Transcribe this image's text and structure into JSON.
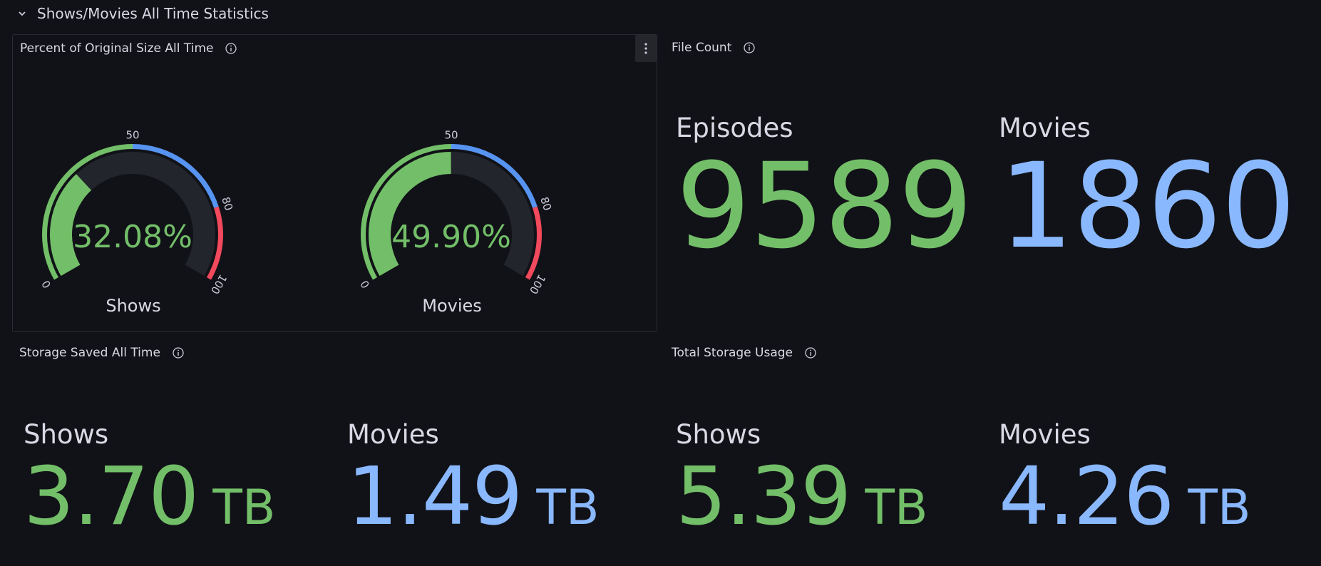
{
  "row": {
    "title": "Shows/Movies All Time Statistics"
  },
  "percent_panel": {
    "title": "Percent of Original Size All Time",
    "gauges": [
      {
        "label": "Shows",
        "value": 32.08,
        "display": "32.08%"
      },
      {
        "label": "Movies",
        "value": 49.9,
        "display": "49.90%"
      }
    ],
    "ticks": [
      "0",
      "50",
      "80",
      "100"
    ],
    "thresholds": {
      "green": "#73bf69",
      "blue": "#5794f2",
      "red": "#f2495c"
    }
  },
  "file_count_panel": {
    "title": "File Count",
    "stats": [
      {
        "label": "Episodes",
        "value": "9589"
      },
      {
        "label": "Movies",
        "value": "1860"
      }
    ]
  },
  "storage_saved_panel": {
    "title": "Storage Saved All Time",
    "stats": [
      {
        "label": "Shows",
        "value": "3.70",
        "unit": "TB"
      },
      {
        "label": "Movies",
        "value": "1.49",
        "unit": "TB"
      }
    ]
  },
  "total_storage_panel": {
    "title": "Total Storage Usage",
    "stats": [
      {
        "label": "Shows",
        "value": "5.39",
        "unit": "TB"
      },
      {
        "label": "Movies",
        "value": "4.26",
        "unit": "TB"
      }
    ]
  },
  "colors": {
    "green": "#73bf69",
    "blue": "#8ab8ff",
    "background": "#111217"
  }
}
